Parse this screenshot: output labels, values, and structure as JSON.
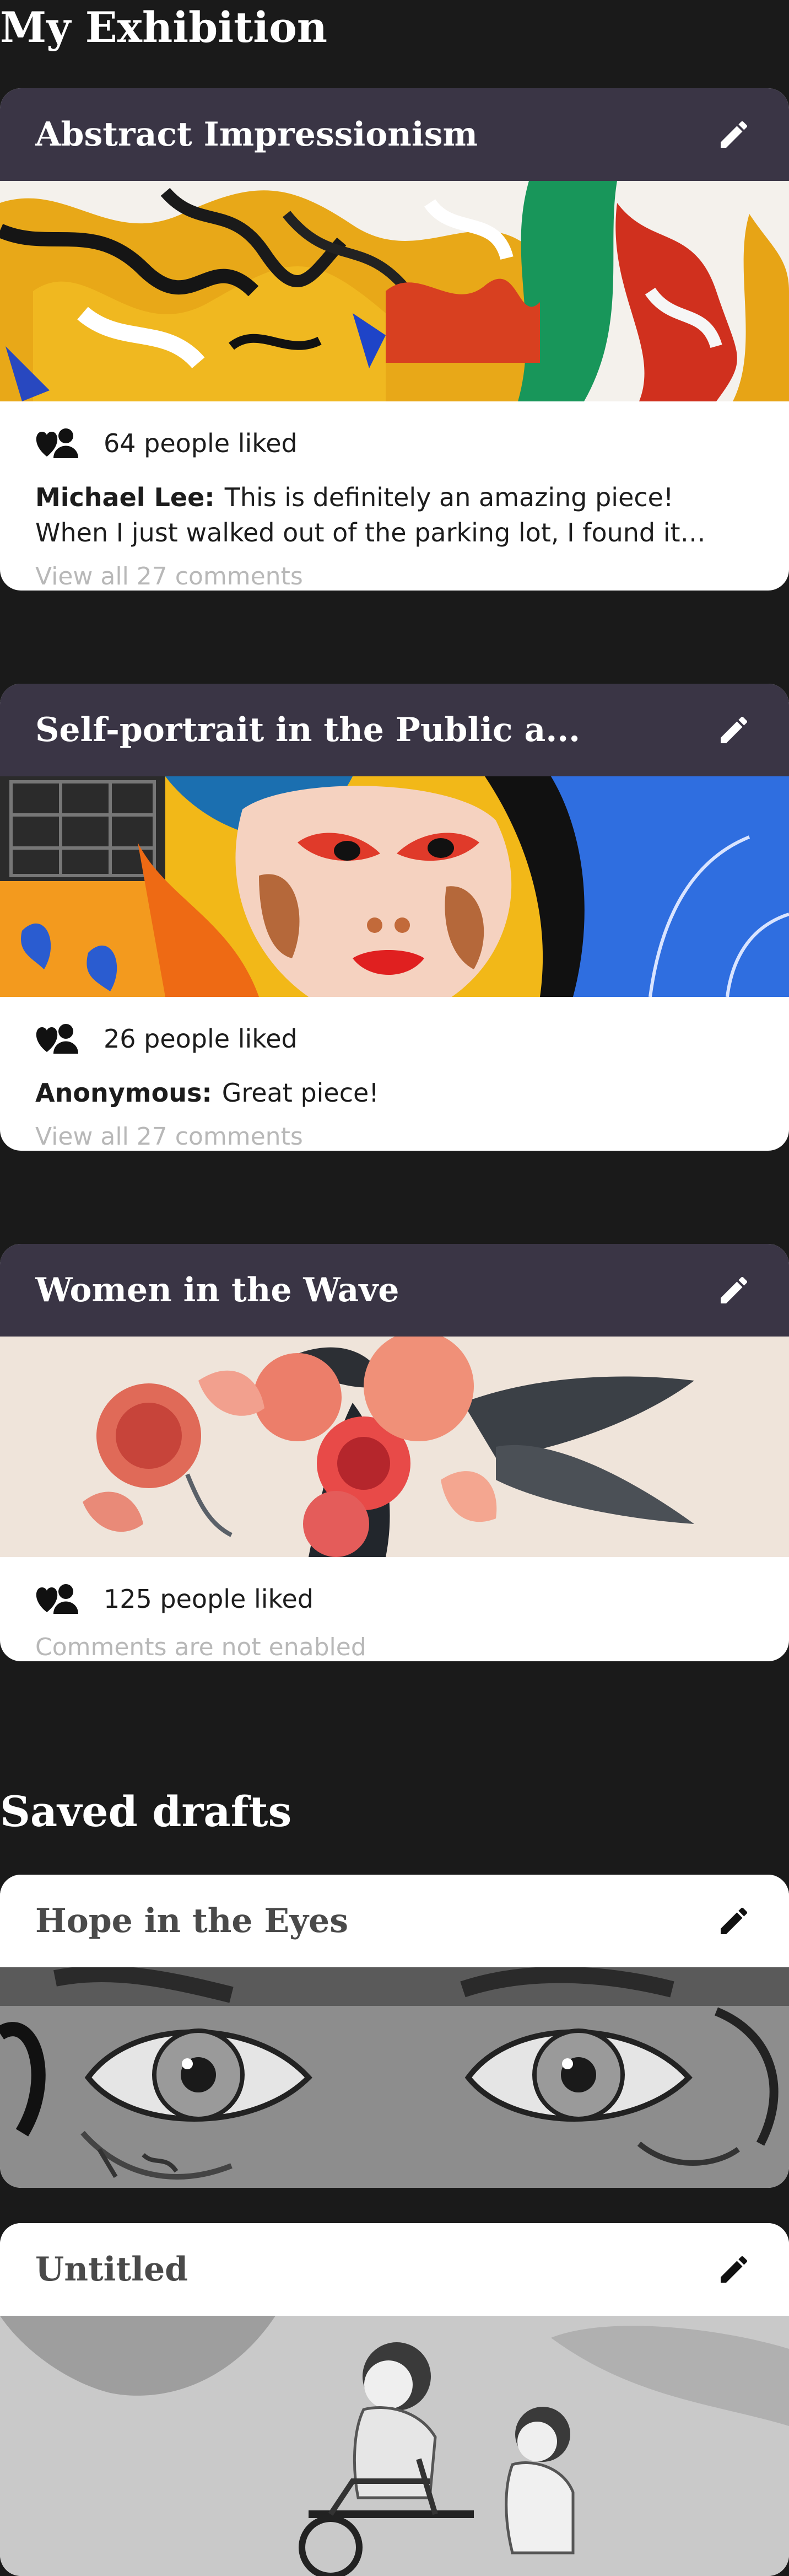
{
  "exhibition": {
    "title": "My Exhibition",
    "cards": [
      {
        "title": "Abstract Impressionism",
        "likes": "64 people liked",
        "comment_author": "Michael Lee:",
        "comment_text": "This is definitely an amazing piece! When I just walked out of the parking lot, I found it standing in...",
        "comments_link": "View all 27 comments"
      },
      {
        "title": "Self-portrait in the Public a...",
        "likes": "26 people liked",
        "comment_author": "Anonymous:",
        "comment_text": "Great piece!",
        "comments_link": "View all 27 comments"
      },
      {
        "title": "Women in the Wave",
        "likes": "125 people liked",
        "comments_disabled": "Comments are not enabled"
      }
    ]
  },
  "drafts": {
    "title": "Saved drafts",
    "cards": [
      {
        "title": "Hope in the Eyes"
      },
      {
        "title": "Untitled"
      }
    ]
  },
  "colors": {
    "background": "#1a1a1a",
    "card_header_dark": "#3a3545",
    "card_body": "#ffffff",
    "muted_text": "#b8b8b8"
  },
  "icons": {
    "edit": "pencil-icon",
    "likes": "person-heart-icon"
  }
}
